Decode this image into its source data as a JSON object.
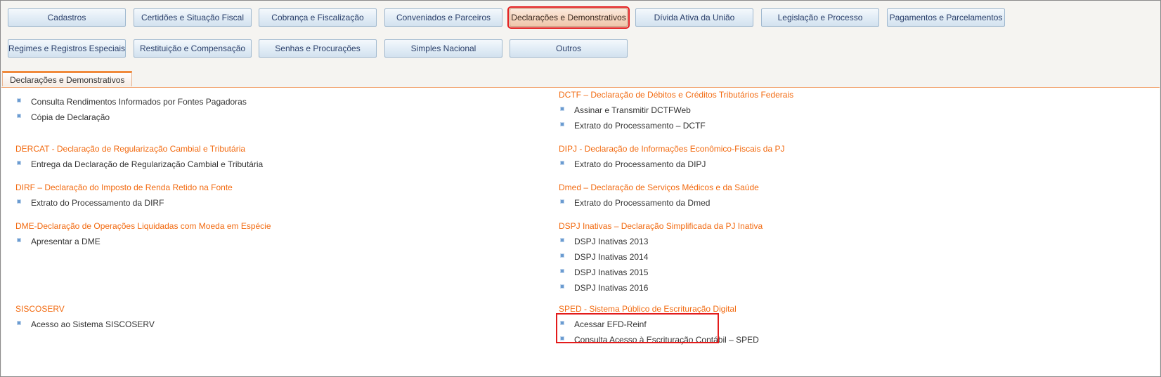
{
  "categories": {
    "row1": [
      "Cadastros",
      "Certidões e Situação Fiscal",
      "Cobrança e Fiscalização",
      "Conveniados e Parceiros",
      "Declarações e Demonstrativos",
      "Dívida Ativa da União",
      "Legislação e  Processo",
      "Pagamentos e Parcelamentos"
    ],
    "row2": [
      "Regimes e Registros Especiais",
      "Restituição e Compensação",
      "Senhas e Procurações",
      "Simples Nacional",
      "Outros"
    ],
    "active": "Declarações e Demonstrativos"
  },
  "tab": {
    "label": "Declarações e Demonstrativos"
  },
  "left_sections": [
    {
      "title": "",
      "items": [
        "Consulta Rendimentos Informados por Fontes Pagadoras",
        "Cópia de Declaração"
      ]
    },
    {
      "title": "DERCAT - Declaração de Regularização Cambial e Tributária",
      "items": [
        "Entrega da Declaração de Regularização Cambial e Tributária"
      ]
    },
    {
      "title": "DIRF – Declaração do Imposto de Renda Retido na Fonte",
      "items": [
        "Extrato do Processamento da DIRF"
      ]
    },
    {
      "title": "DME-Declaração de Operações Liquidadas com Moeda em Espécie",
      "items": [
        "Apresentar a DME"
      ]
    },
    {
      "title": "SISCOSERV",
      "items": [
        "Acesso ao Sistema SISCOSERV"
      ]
    }
  ],
  "right_sections": [
    {
      "title": "DCTF – Declaração de Débitos e Créditos Tributários Federais",
      "items": [
        "Assinar e Transmitir DCTFWeb",
        "Extrato do Processamento – DCTF"
      ]
    },
    {
      "title": "DIPJ - Declaração de Informações Econômico-Fiscais da PJ",
      "items": [
        "Extrato do Processamento da DIPJ"
      ]
    },
    {
      "title": "Dmed – Declaração de Serviços Médicos e da Saúde",
      "items": [
        "Extrato do Processamento da Dmed"
      ]
    },
    {
      "title": "DSPJ Inativas – Declaração Simplificada da PJ Inativa",
      "items": [
        "DSPJ Inativas 2013",
        "DSPJ Inativas 2014",
        "DSPJ Inativas 2015",
        "DSPJ Inativas 2016"
      ]
    },
    {
      "title": "SPED - Sistema Público de Escrituração Digital",
      "items": [
        "Acessar EFD-Reinf",
        "Consulta Acesso à Escrituração Contábil – SPED"
      ]
    }
  ],
  "colors": {
    "accent": "#f26a10",
    "highlight": "#e31b1b",
    "button_text": "#2a3f6a"
  }
}
